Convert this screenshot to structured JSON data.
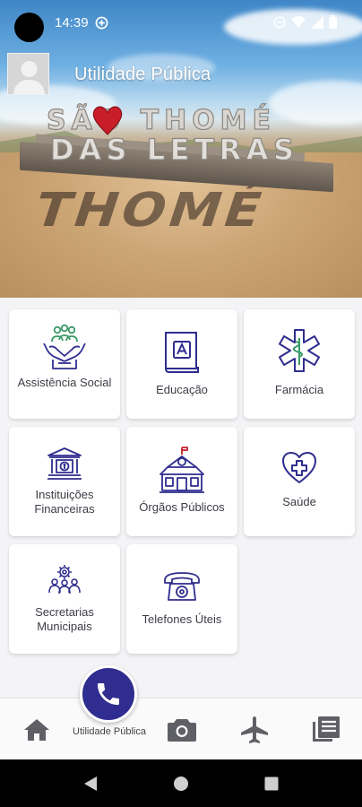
{
  "status_bar": {
    "time": "14:39"
  },
  "header": {
    "title": "Utilidade Pública"
  },
  "banner": {
    "sign_top": "SÃO THOMÉ",
    "sign_bottom": "DAS LETRAS"
  },
  "services": [
    {
      "label": "Assistência Social",
      "icon": "helping-hands-icon"
    },
    {
      "label": "Educação",
      "icon": "book-icon"
    },
    {
      "label": "Farmácia",
      "icon": "medical-star-icon"
    },
    {
      "label": "Instituições Financeiras",
      "icon": "bank-icon"
    },
    {
      "label": "Órgãos Públicos",
      "icon": "public-building-icon"
    },
    {
      "label": "Saúde",
      "icon": "heart-cross-icon"
    },
    {
      "label": "Secretarias Municipais",
      "icon": "team-gear-icon"
    },
    {
      "label": "Telefones Úteis",
      "icon": "telephone-icon"
    }
  ],
  "bottom_nav": {
    "items": [
      {
        "name": "home",
        "icon": "home-icon"
      },
      {
        "name": "utilidade-publica",
        "icon": "phone-icon",
        "label": "Utilidade Pública",
        "active": true
      },
      {
        "name": "camera",
        "icon": "camera-icon"
      },
      {
        "name": "travel",
        "icon": "airplane-icon"
      },
      {
        "name": "news",
        "icon": "news-icon"
      }
    ]
  },
  "colors": {
    "accent": "#2f2d8f",
    "icon_stroke": "#2f2d8f",
    "card_bg": "#ffffff",
    "page_bg": "#f4f4f6"
  }
}
